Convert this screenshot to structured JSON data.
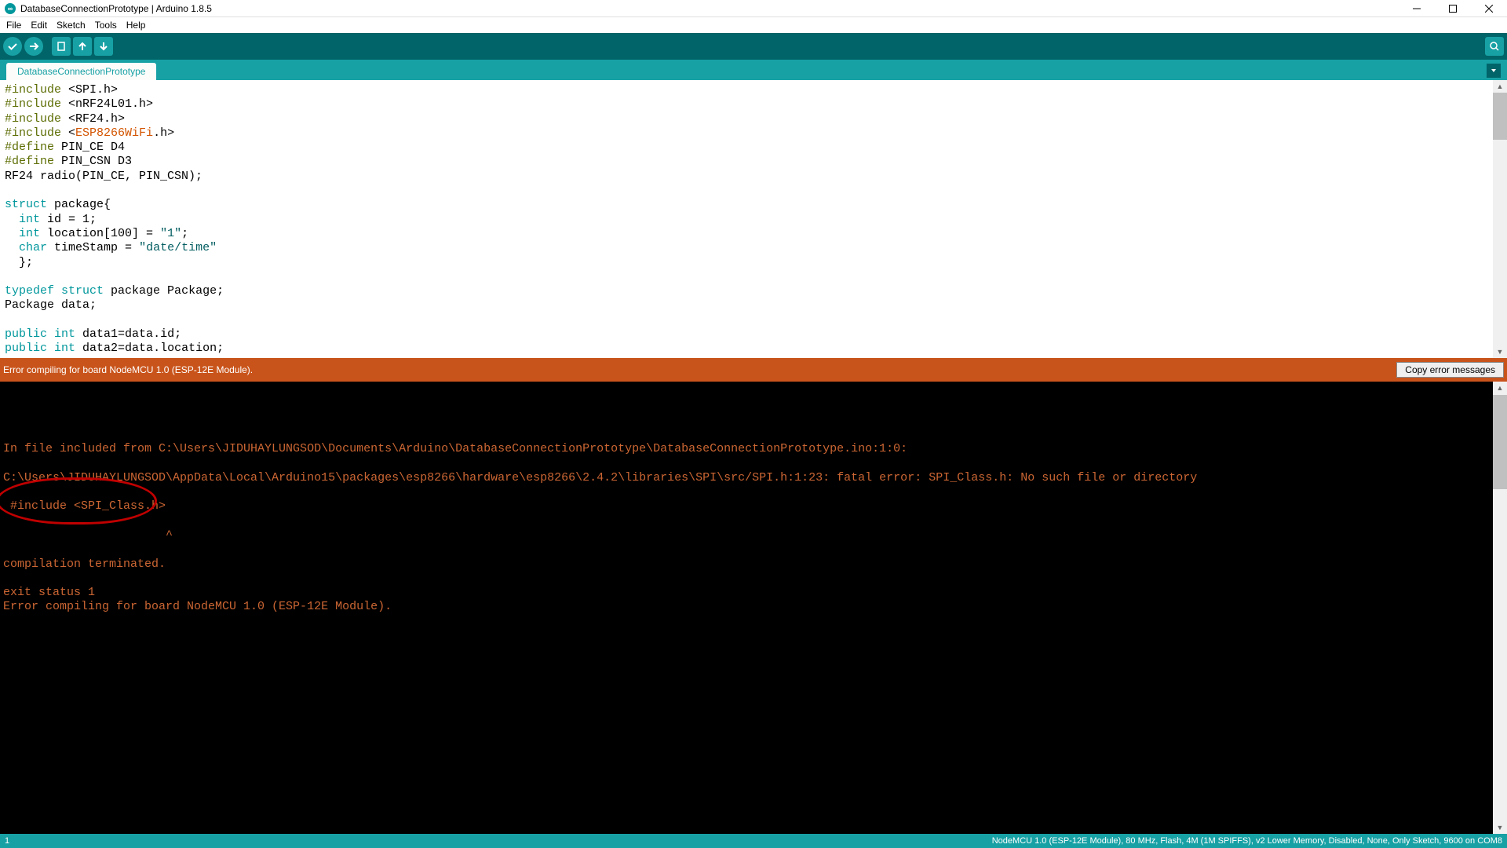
{
  "window": {
    "title": "DatabaseConnectionPrototype | Arduino 1.8.5",
    "app_badge": "∞"
  },
  "menu": [
    "File",
    "Edit",
    "Sketch",
    "Tools",
    "Help"
  ],
  "toolbar": {
    "verify": "✓",
    "upload": "→",
    "new": "🗋",
    "open": "↑",
    "save": "↓",
    "serial": "🔍"
  },
  "tab": {
    "label": "DatabaseConnectionPrototype"
  },
  "code": {
    "lines": [
      {
        "t": "pp",
        "s": "#include "
      },
      {
        "t": "",
        "s": "<SPI.h>\n"
      },
      {
        "t": "pp",
        "s": "#include "
      },
      {
        "t": "",
        "s": "<nRF24L01.h>\n"
      },
      {
        "t": "pp",
        "s": "#include "
      },
      {
        "t": "",
        "s": "<RF24.h>\n"
      },
      {
        "t": "pp",
        "s": "#include "
      },
      {
        "t": "",
        "s": "<"
      },
      {
        "t": "lib",
        "s": "ESP8266WiFi"
      },
      {
        "t": "",
        "s": ".h>\n"
      },
      {
        "t": "pp",
        "s": "#define "
      },
      {
        "t": "",
        "s": "PIN_CE D4\n"
      },
      {
        "t": "pp",
        "s": "#define "
      },
      {
        "t": "",
        "s": "PIN_CSN D3\n"
      },
      {
        "t": "",
        "s": "RF24 radio(PIN_CE, PIN_CSN);\n"
      },
      {
        "t": "",
        "s": "\n"
      },
      {
        "t": "kw",
        "s": "struct"
      },
      {
        "t": "",
        "s": " package{\n"
      },
      {
        "t": "",
        "s": "  "
      },
      {
        "t": "type",
        "s": "int"
      },
      {
        "t": "",
        "s": " id = 1;\n"
      },
      {
        "t": "",
        "s": "  "
      },
      {
        "t": "type",
        "s": "int"
      },
      {
        "t": "",
        "s": " location[100] = "
      },
      {
        "t": "str",
        "s": "\"1\""
      },
      {
        "t": "",
        "s": ";\n"
      },
      {
        "t": "",
        "s": "  "
      },
      {
        "t": "type",
        "s": "char"
      },
      {
        "t": "",
        "s": " timeStamp = "
      },
      {
        "t": "str",
        "s": "\"date/time\""
      },
      {
        "t": "",
        "s": "\n"
      },
      {
        "t": "",
        "s": "  };\n"
      },
      {
        "t": "",
        "s": "\n"
      },
      {
        "t": "kw",
        "s": "typedef"
      },
      {
        "t": "",
        "s": " "
      },
      {
        "t": "kw",
        "s": "struct"
      },
      {
        "t": "",
        "s": " package Package;\n"
      },
      {
        "t": "",
        "s": "Package data;\n"
      },
      {
        "t": "",
        "s": "\n"
      },
      {
        "t": "kw",
        "s": "public"
      },
      {
        "t": "",
        "s": " "
      },
      {
        "t": "type",
        "s": "int"
      },
      {
        "t": "",
        "s": " data1=data.id;\n"
      },
      {
        "t": "kw",
        "s": "public"
      },
      {
        "t": "",
        "s": " "
      },
      {
        "t": "type",
        "s": "int"
      },
      {
        "t": "",
        "s": " data2=data.location;\n"
      }
    ]
  },
  "status": {
    "error_summary": "Error compiling for board NodeMCU 1.0 (ESP-12E Module).",
    "copy_label": "Copy error messages"
  },
  "console_text": "\n\n\nIn file included from C:\\Users\\JIDUHAYLUNGSOD\\Documents\\Arduino\\DatabaseConnectionPrototype\\DatabaseConnectionPrototype.ino:1:0:\n\nC:\\Users\\JIDUHAYLUNGSOD\\AppData\\Local\\Arduino15\\packages\\esp8266\\hardware\\esp8266\\2.4.2\\libraries\\SPI\\src/SPI.h:1:23: fatal error: SPI_Class.h: No such file or directory\n\n #include <SPI_Class.h>\n\n                       ^\n\ncompilation terminated.\n\nexit status 1\nError compiling for board NodeMCU 1.0 (ESP-12E Module).",
  "footer": {
    "left": "1",
    "right": "NodeMCU 1.0 (ESP-12E Module), 80 MHz, Flash, 4M (1M SPIFFS), v2 Lower Memory, Disabled, None, Only Sketch, 9600 on COM8"
  }
}
